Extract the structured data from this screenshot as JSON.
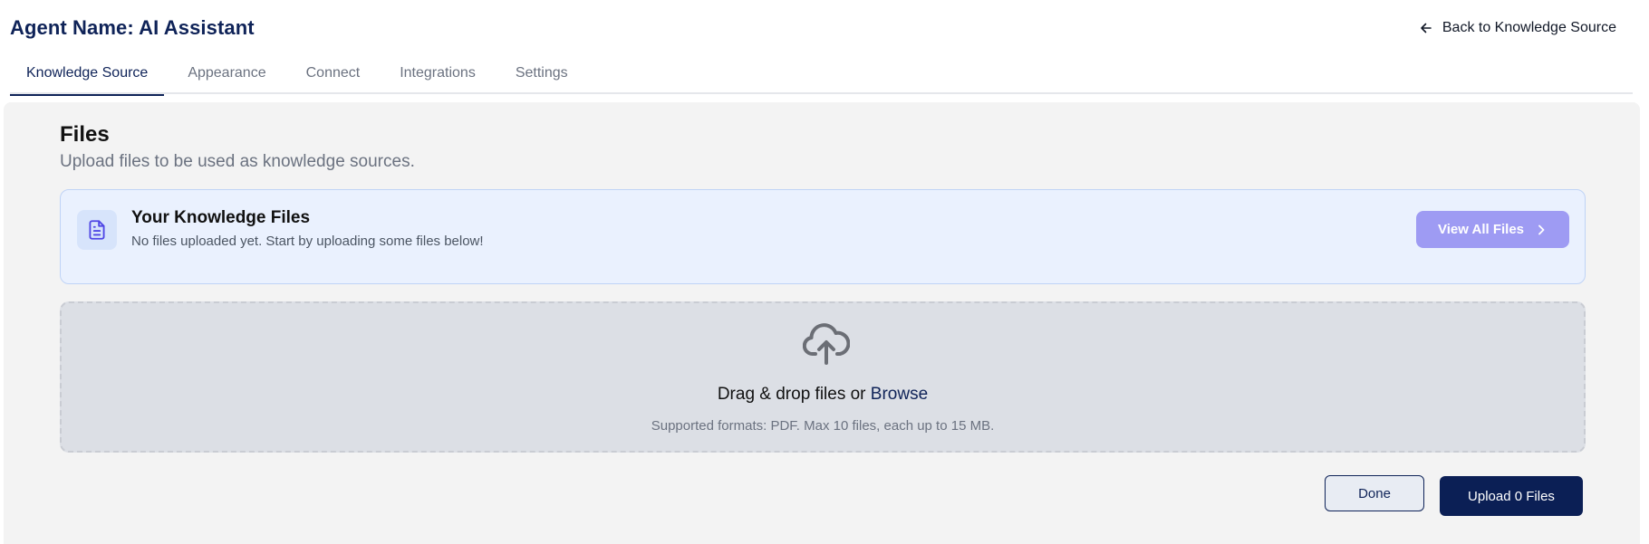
{
  "header": {
    "agent_title": "Agent Name: AI Assistant",
    "back_label": "Back to Knowledge Source"
  },
  "tabs": [
    {
      "label": "Knowledge Source",
      "active": true
    },
    {
      "label": "Appearance",
      "active": false
    },
    {
      "label": "Connect",
      "active": false
    },
    {
      "label": "Integrations",
      "active": false
    },
    {
      "label": "Settings",
      "active": false
    }
  ],
  "main": {
    "title": "Files",
    "subtitle": "Upload files to be used as knowledge sources.",
    "knowledge_card": {
      "icon": "document-icon",
      "title": "Your Knowledge Files",
      "description": "No files uploaded yet. Start by uploading some files below!",
      "view_all_label": "View All Files"
    },
    "dropzone": {
      "icon": "cloud-upload-icon",
      "prompt": "Drag & drop files or ",
      "browse_label": "Browse",
      "hint": "Supported formats: PDF. Max 10 files, each up to 15 MB."
    },
    "actions": {
      "done_label": "Done",
      "upload_label": "Upload 0 Files"
    }
  },
  "colors": {
    "brand_navy": "#0f2358",
    "view_all_button": "#9e9bf3",
    "card_background": "#eaf1fe",
    "dropzone_background": "#dcdfe5"
  }
}
